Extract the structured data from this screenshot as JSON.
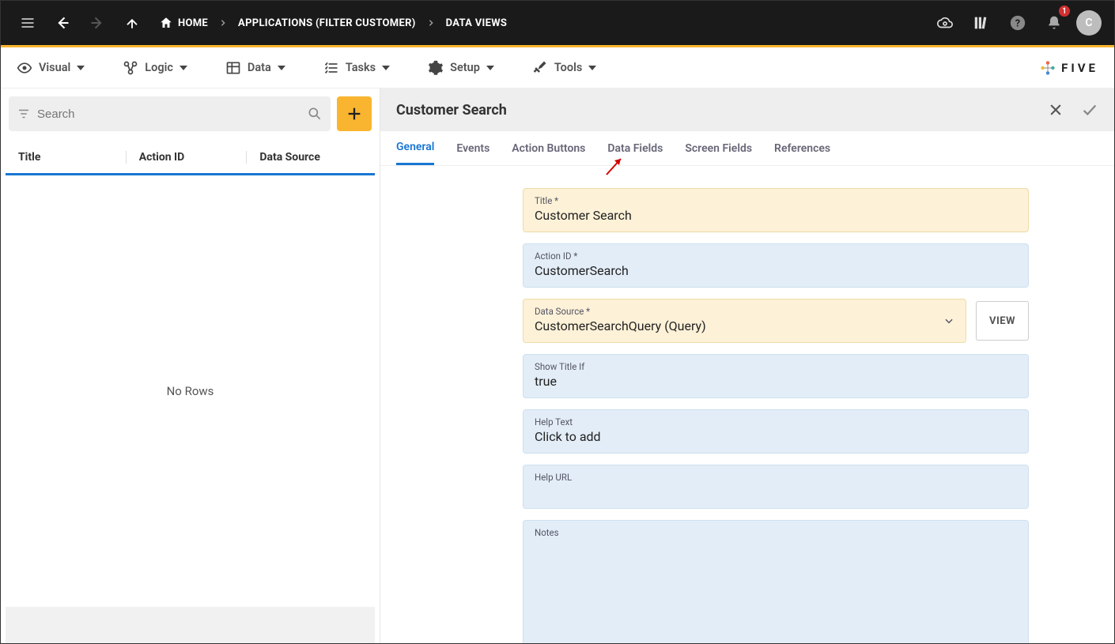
{
  "topbar": {
    "home_label": "HOME",
    "crumb_app": "APPLICATIONS (FILTER CUSTOMER)",
    "crumb_views": "DATA VIEWS",
    "notif_count": "1",
    "avatar_letter": "C"
  },
  "menus": {
    "visual": "Visual",
    "logic": "Logic",
    "data": "Data",
    "tasks": "Tasks",
    "setup": "Setup",
    "tools": "Tools"
  },
  "brand": {
    "name": "FIVE"
  },
  "left": {
    "search_placeholder": "Search",
    "cols": {
      "title": "Title",
      "action_id": "Action ID",
      "data_source": "Data Source"
    },
    "no_rows": "No Rows"
  },
  "panel": {
    "title": "Customer Search",
    "tabs": {
      "general": "General",
      "events": "Events",
      "action_buttons": "Action Buttons",
      "data_fields": "Data Fields",
      "screen_fields": "Screen Fields",
      "references": "References"
    },
    "view_btn": "VIEW"
  },
  "form": {
    "title_label": "Title *",
    "title_value": "Customer Search",
    "action_id_label": "Action ID *",
    "action_id_value": "CustomerSearch",
    "data_source_label": "Data Source *",
    "data_source_value": "CustomerSearchQuery (Query)",
    "show_title_if_label": "Show Title If",
    "show_title_if_value": "true",
    "help_text_label": "Help Text",
    "help_text_value": "Click to add",
    "help_url_label": "Help URL",
    "help_url_value": "",
    "notes_label": "Notes",
    "notes_value": ""
  }
}
